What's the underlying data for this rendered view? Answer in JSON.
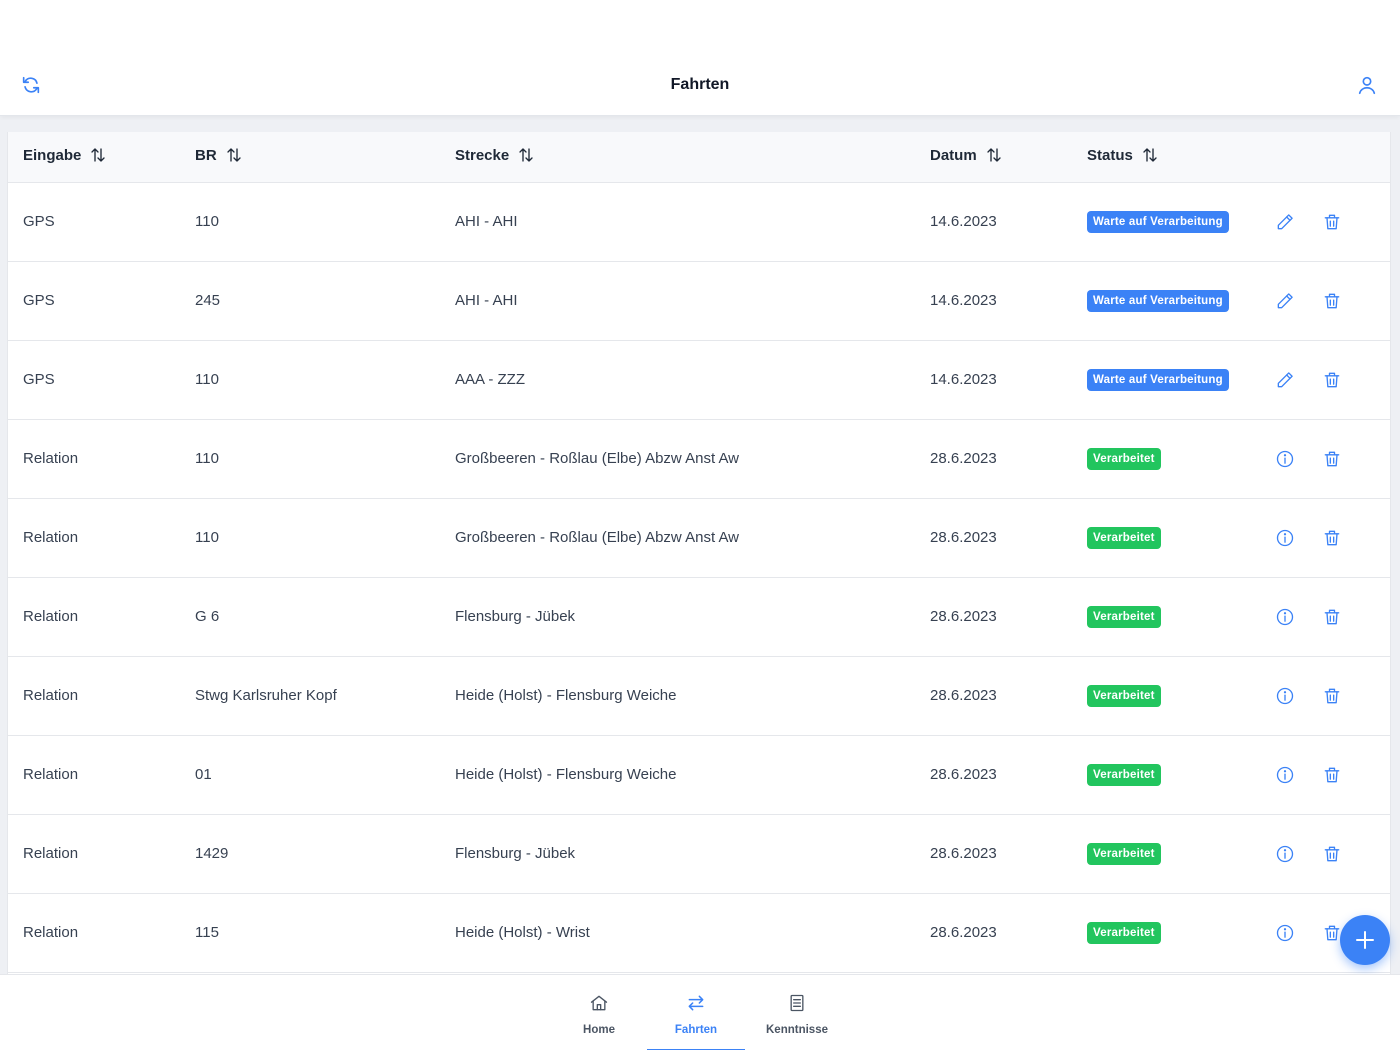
{
  "header": {
    "title": "Fahrten",
    "refresh_icon": "refresh-icon",
    "user_icon": "user-icon",
    "accent": "#3b82f6"
  },
  "table": {
    "columns": [
      {
        "label": "Eingabe"
      },
      {
        "label": "BR"
      },
      {
        "label": "Strecke"
      },
      {
        "label": "Datum"
      },
      {
        "label": "Status"
      }
    ],
    "rows": [
      {
        "eingabe": "GPS",
        "br": "110",
        "strecke": "AHI - AHI",
        "datum": "14.6.2023",
        "status": "Warte auf Verarbeitung",
        "status_color": "#3b82f6",
        "primary_action": "edit-icon"
      },
      {
        "eingabe": "GPS",
        "br": "245",
        "strecke": "AHI - AHI",
        "datum": "14.6.2023",
        "status": "Warte auf Verarbeitung",
        "status_color": "#3b82f6",
        "primary_action": "edit-icon"
      },
      {
        "eingabe": "GPS",
        "br": "110",
        "strecke": "AAA - ZZZ",
        "datum": "14.6.2023",
        "status": "Warte auf Verarbeitung",
        "status_color": "#3b82f6",
        "primary_action": "edit-icon"
      },
      {
        "eingabe": "Relation",
        "br": "110",
        "strecke": "Großbeeren - Roßlau (Elbe) Abzw Anst Aw",
        "datum": "28.6.2023",
        "status": "Verarbeitet",
        "status_color": "#22c55e",
        "primary_action": "info-icon"
      },
      {
        "eingabe": "Relation",
        "br": "110",
        "strecke": "Großbeeren - Roßlau (Elbe) Abzw Anst Aw",
        "datum": "28.6.2023",
        "status": "Verarbeitet",
        "status_color": "#22c55e",
        "primary_action": "info-icon"
      },
      {
        "eingabe": "Relation",
        "br": "G 6",
        "strecke": "Flensburg - Jübek",
        "datum": "28.6.2023",
        "status": "Verarbeitet",
        "status_color": "#22c55e",
        "primary_action": "info-icon"
      },
      {
        "eingabe": "Relation",
        "br": "Stwg Karlsruher Kopf",
        "strecke": "Heide (Holst) - Flensburg Weiche",
        "datum": "28.6.2023",
        "status": "Verarbeitet",
        "status_color": "#22c55e",
        "primary_action": "info-icon"
      },
      {
        "eingabe": "Relation",
        "br": "01",
        "strecke": "Heide (Holst) - Flensburg Weiche",
        "datum": "28.6.2023",
        "status": "Verarbeitet",
        "status_color": "#22c55e",
        "primary_action": "info-icon"
      },
      {
        "eingabe": "Relation",
        "br": "1429",
        "strecke": "Flensburg - Jübek",
        "datum": "28.6.2023",
        "status": "Verarbeitet",
        "status_color": "#22c55e",
        "primary_action": "info-icon"
      },
      {
        "eingabe": "Relation",
        "br": "115",
        "strecke": "Heide (Holst) - Wrist",
        "datum": "28.6.2023",
        "status": "Verarbeitet",
        "status_color": "#22c55e",
        "primary_action": "info-icon"
      }
    ]
  },
  "fab": {
    "icon": "plus-icon"
  },
  "bottom_nav": {
    "items": [
      {
        "label": "Home",
        "icon": "home-icon",
        "active": false
      },
      {
        "label": "Fahrten",
        "icon": "swap-arrows-icon",
        "active": true
      },
      {
        "label": "Kenntnisse",
        "icon": "document-list-icon",
        "active": false
      }
    ],
    "active_color": "#3b82f6",
    "inactive_color": "#4b5563"
  }
}
